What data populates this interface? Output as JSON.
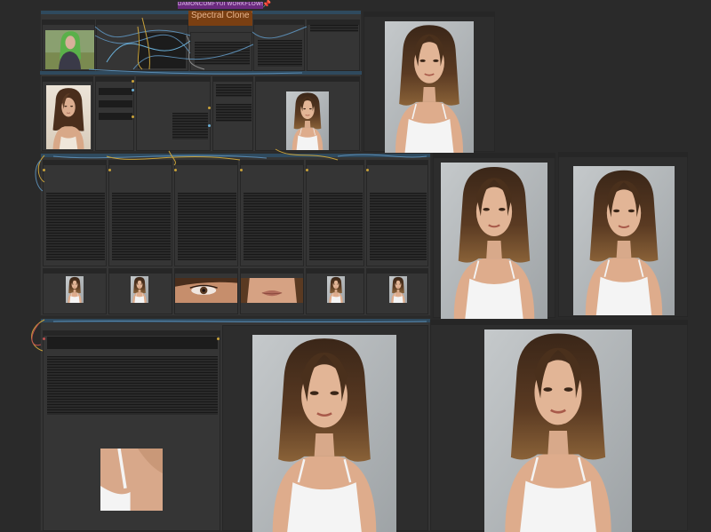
{
  "workflow": {
    "banner_label": "DAMONCOMFYUI WORKFLOWS SERIES",
    "title": "Spectral Clone V1",
    "subtitle": "",
    "pin_glyph": "📌"
  },
  "colors": {
    "canvas": "#2a2a2a",
    "node": "#353535",
    "group_header": "#2f4a5e",
    "banner": "#6a2a7e",
    "title_box": "#7a3f12",
    "wire_blue": "#5a8ab0",
    "wire_yellow": "#c9a23a"
  },
  "images": {
    "input_reference": "green-haired-woman-reference",
    "source_portrait": "woman-portrait-beige-background",
    "face_crop_eye": "eye-closeup",
    "face_crop_lips": "lips-closeup",
    "shoulder_crop": "shoulder-closeup",
    "output_portrait": "woman-portrait-grey-wall"
  }
}
